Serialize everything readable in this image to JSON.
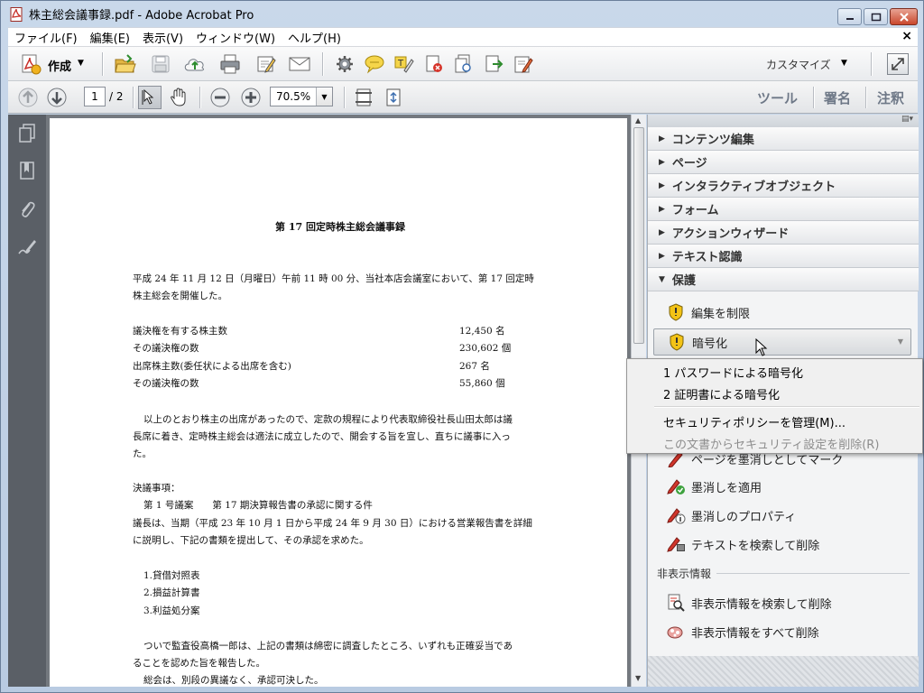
{
  "window": {
    "title": "株主総会議事録.pdf - Adobe Acrobat Pro"
  },
  "menubar": {
    "items": [
      "ファイル(F)",
      "編集(E)",
      "表示(V)",
      "ウィンドウ(W)",
      "ヘルプ(H)"
    ],
    "close_glyph": "×"
  },
  "toolbar": {
    "create_label": "作成",
    "customize_label": "カスタマイズ"
  },
  "nav": {
    "page_current": "1",
    "page_total": "/ 2",
    "zoom": "70.5%"
  },
  "panel_links": {
    "tools": "ツール",
    "sign": "署名",
    "comment": "注釈"
  },
  "document": {
    "title": "第 17 回定時株主総会議事録",
    "intro1": "平成 24 年 11 月 12 日（月曜日）午前 11 時 00 分、当社本店会議室において、第 17 回定時",
    "intro2": "株主総会を開催した。",
    "stats": [
      {
        "label": "議決権を有する株主数",
        "value": "12,450 名"
      },
      {
        "label": "その議決権の数",
        "value": "230,602 個"
      },
      {
        "label": "出席株主数(委任状による出席を含む)",
        "value": "267 名"
      },
      {
        "label": "その議決権の数",
        "value": "55,860 個"
      }
    ],
    "p2_1": "以上のとおり株主の出席があったので、定款の規程により代表取締役社長山田太郎は議",
    "p2_2": "長席に着き、定時株主総会は適法に成立したので、開会する旨を宣し、直ちに議事に入っ",
    "p2_3": "た。",
    "resolutions": "決議事項：",
    "item1": "第 1 号議案　　第 17 期決算報告書の承認に関する件",
    "p3_1": "議長は、当期（平成 23 年 10 月 1 日から平成 24 年 9 月 30 日）における営業報告書を詳細",
    "p3_2": "に説明し、下記の書類を提出して、その承認を求めた。",
    "list": [
      "1.貸借対照表",
      "2.損益計算書",
      "3.利益処分案"
    ],
    "p4_1": "ついで監査役高橋一郎は、上記の書類は綿密に調査したところ、いずれも正確妥当であ",
    "p4_2": "ることを認めた旨を報告した。",
    "p4_3": "総会は、別段の異議なく、承認可決した。"
  },
  "right_panel": {
    "sections": [
      "コンテンツ編集",
      "ページ",
      "インタラクティブオブジェクト",
      "フォーム",
      "アクションウィザード",
      "テキスト認識",
      "保護"
    ],
    "protect_items": [
      "編集を制限",
      "暗号化"
    ],
    "redact_items": [
      "ページを墨消しとしてマーク",
      "墨消しを適用",
      "墨消しのプロパティ",
      "テキストを検索して削除"
    ],
    "hidden_header": "非表示情報",
    "hidden_items": [
      "非表示情報を検索して削除",
      "非表示情報をすべて削除"
    ]
  },
  "popup_menu": {
    "items": [
      {
        "label": "1 パスワードによる暗号化",
        "enabled": true
      },
      {
        "label": "2 証明書による暗号化",
        "enabled": true
      },
      {
        "label": "セキュリティポリシーを管理(M)...",
        "enabled": true
      },
      {
        "label": "この文書からセキュリティ設定を削除(R)",
        "enabled": false
      }
    ]
  },
  "colors": {
    "accent_red": "#c8302a",
    "pen_red": "#d1352b",
    "shield_yellow": "#f3c316",
    "panel_bg": "#f3f4f5"
  }
}
